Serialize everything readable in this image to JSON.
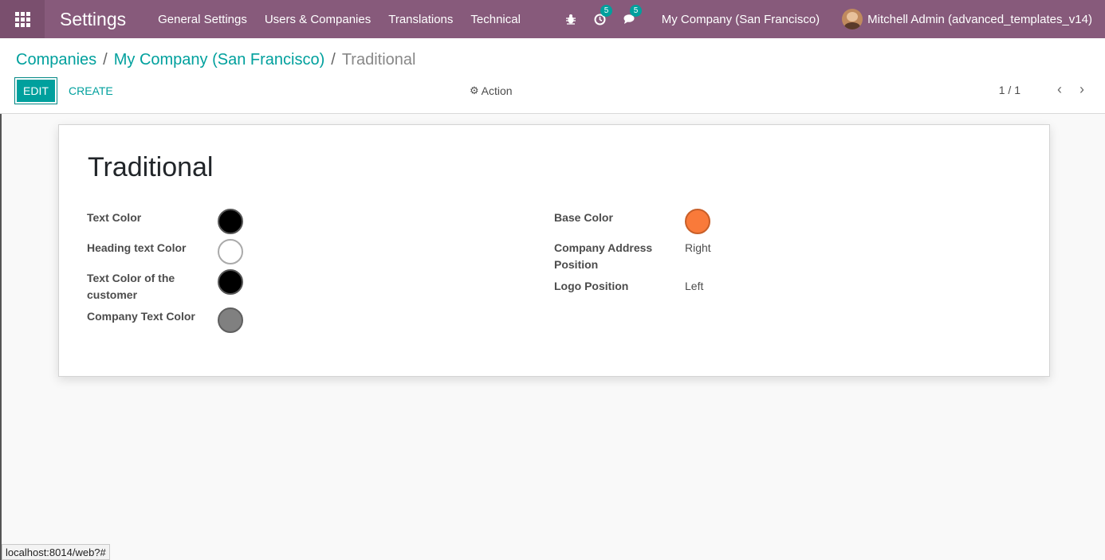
{
  "navbar": {
    "app_title": "Settings",
    "menu": [
      "General Settings",
      "Users & Companies",
      "Translations",
      "Technical"
    ],
    "activity_count": "5",
    "message_count": "5",
    "company": "My Company (San Francisco)",
    "user": "Mitchell Admin (advanced_templates_v14)",
    "icons": [
      "apps-grid-icon",
      "bug-icon",
      "clock-icon",
      "chat-icon"
    ],
    "color": "#875a7b"
  },
  "breadcrumb": {
    "items": [
      "Companies",
      "My Company (San Francisco)"
    ],
    "separator": "/",
    "current": "Traditional"
  },
  "toolbar": {
    "edit_label": "EDIT",
    "create_label": "CREATE",
    "action_label": "Action",
    "pager": "1 / 1"
  },
  "record": {
    "title": "Traditional",
    "left_fields": [
      {
        "label": "Text Color",
        "color": "#000000"
      },
      {
        "label": "Heading text Color",
        "color": "#ffffff"
      },
      {
        "label": "Text Color of the customer",
        "color": "#000000"
      },
      {
        "label": "Company Text Color",
        "color": "#808080"
      }
    ],
    "right_fields": {
      "base_color_label": "Base Color",
      "base_color": "#f97a3a",
      "address_position_label": "Company Address Position",
      "address_position_value": "Right",
      "logo_position_label": "Logo Position",
      "logo_position_value": "Left"
    }
  },
  "status_bar": {
    "url": "localhost:8014/web?#"
  },
  "accent_color": "#00a09d"
}
